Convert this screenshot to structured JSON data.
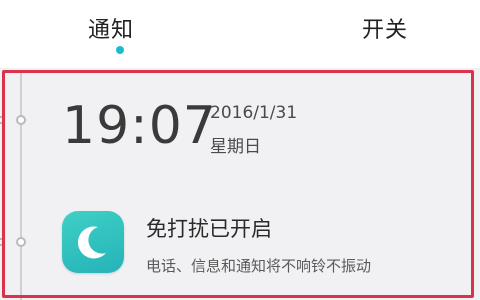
{
  "tabs": {
    "notify_label": "通知",
    "switch_label": "开关",
    "active_indicator_color": "#1bbcc8"
  },
  "clock": {
    "time": "19:07",
    "date": "2016/1/31",
    "weekday": "星期日"
  },
  "notification": {
    "icon": "moon-icon",
    "title": "免打扰已开启",
    "body": "电话、信息和通知将不响铃不振动"
  },
  "highlight_color": "#d8334a"
}
